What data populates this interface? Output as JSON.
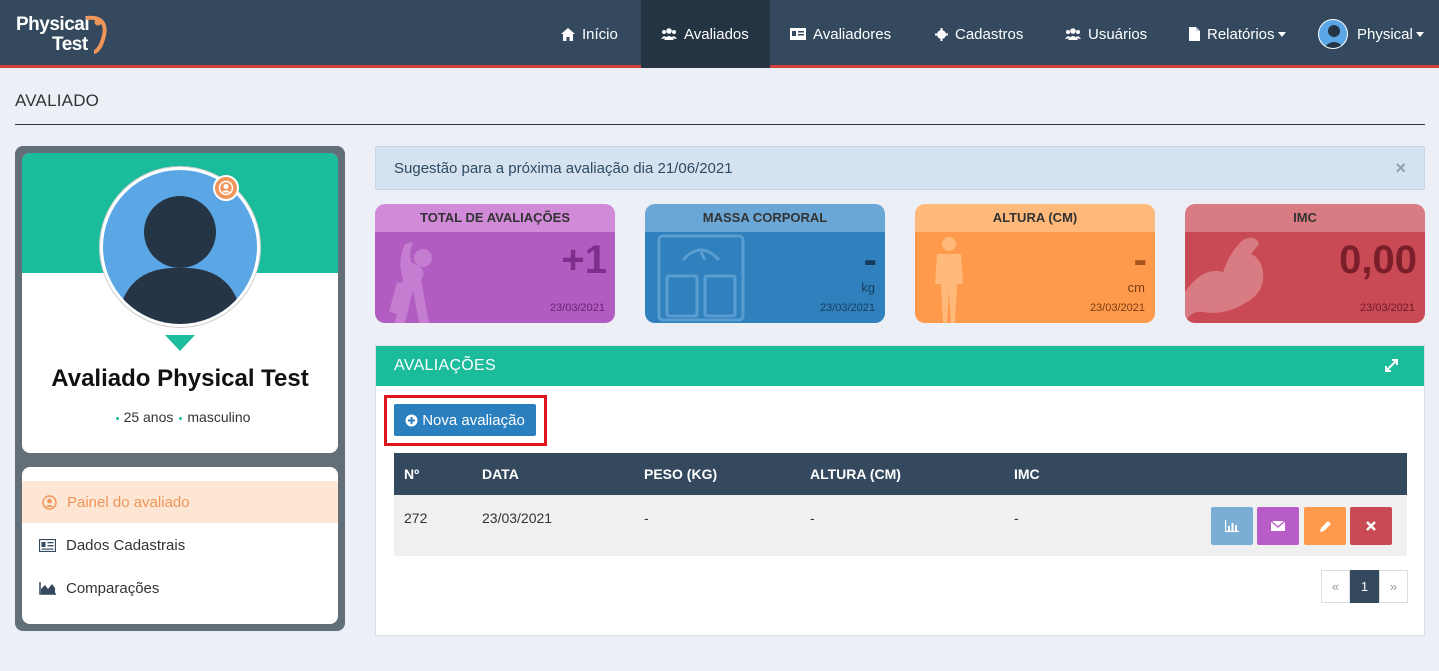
{
  "navbar": {
    "logo_line1": "Physical",
    "logo_line2": "Test",
    "items": [
      {
        "label": "Início",
        "icon": "home-icon"
      },
      {
        "label": "Avaliados",
        "icon": "users-icon",
        "active": true
      },
      {
        "label": "Avaliadores",
        "icon": "id-card-icon"
      },
      {
        "label": "Cadastros",
        "icon": "gear-icon"
      },
      {
        "label": "Usuários",
        "icon": "users-icon"
      },
      {
        "label": "Relatórios",
        "icon": "file-icon"
      }
    ],
    "user_label": "Physical"
  },
  "page": {
    "title": "AVALIADO"
  },
  "profile": {
    "name": "Avaliado Physical Test",
    "age": "25 anos",
    "gender": "masculino"
  },
  "menu": [
    {
      "label": "Painel do avaliado",
      "icon": "user-circle-icon",
      "active": true
    },
    {
      "label": "Dados Cadastrais",
      "icon": "id-card-icon"
    },
    {
      "label": "Comparações",
      "icon": "area-chart-icon"
    }
  ],
  "alert": {
    "text": "Sugestão para a próxima avaliação dia 21/06/2021",
    "close": "×"
  },
  "stats": [
    {
      "title": "TOTAL DE AVALIAÇÕES",
      "value": "+1",
      "unit": "",
      "date": "23/03/2021",
      "head_color": "#d08ad8",
      "body_color": "#b05cc0"
    },
    {
      "title": "MASSA CORPORAL",
      "value": "-",
      "unit": "kg",
      "date": "23/03/2021",
      "head_color": "#6aa7d6",
      "body_color": "#2f80bd"
    },
    {
      "title": "ALTURA (CM)",
      "value": "-",
      "unit": "cm",
      "date": "23/03/2021",
      "head_color": "#ffb97a",
      "body_color": "#ff9a4c"
    },
    {
      "title": "IMC",
      "value": "0,00",
      "unit": "",
      "date": "23/03/2021",
      "head_color": "#d97b82",
      "body_color": "#c94a55"
    }
  ],
  "evaluations": {
    "title": "AVALIAÇÕES",
    "new_button": "Nova avaliação",
    "columns": [
      "Nº",
      "DATA",
      "PESO (KG)",
      "ALTURA (CM)",
      "IMC"
    ],
    "rows": [
      {
        "num": "272",
        "date": "23/03/2021",
        "weight": "-",
        "height": "-",
        "imc": "-"
      }
    ],
    "actions": [
      {
        "icon": "bar-chart-icon",
        "color": "#7aaed3"
      },
      {
        "icon": "envelope-icon",
        "color": "#b85cc7"
      },
      {
        "icon": "pencil-icon",
        "color": "#ff9a4c"
      },
      {
        "icon": "times-icon",
        "color": "#c94a55"
      }
    ],
    "pagination": {
      "prev": "«",
      "current": "1",
      "next": "»"
    }
  }
}
